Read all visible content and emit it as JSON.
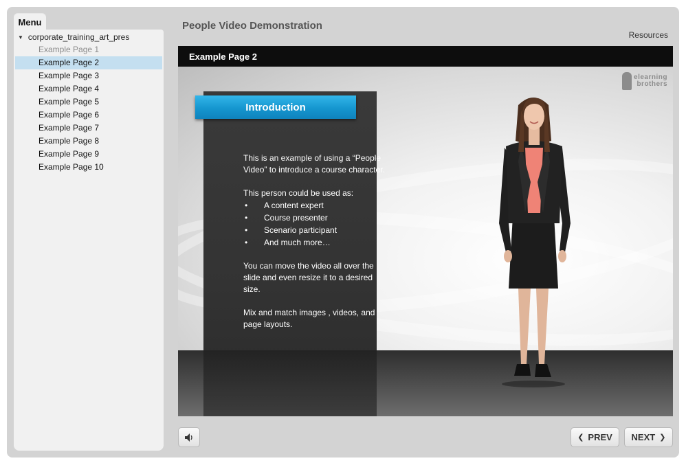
{
  "sidebar": {
    "tab_label": "Menu",
    "root_label": "corporate_training_art_pres",
    "items": [
      {
        "label": "Example Page 1",
        "state": "visited"
      },
      {
        "label": "Example Page 2",
        "state": "active"
      },
      {
        "label": "Example Page 3",
        "state": "default"
      },
      {
        "label": "Example Page 4",
        "state": "default"
      },
      {
        "label": "Example Page 5",
        "state": "default"
      },
      {
        "label": "Example Page 6",
        "state": "default"
      },
      {
        "label": "Example Page 7",
        "state": "default"
      },
      {
        "label": "Example Page 8",
        "state": "default"
      },
      {
        "label": "Example Page 9",
        "state": "default"
      },
      {
        "label": "Example Page 10",
        "state": "default"
      }
    ]
  },
  "header": {
    "title": "People Video Demonstration",
    "resources_label": "Resources",
    "page_title": "Example Page 2"
  },
  "slide": {
    "logo_line1": "elearning",
    "logo_line2": "brothers",
    "banner": "Introduction",
    "para1": "This is an example of using a “People Video” to introduce a course character.",
    "para2": "This person could be used as:",
    "bullets": [
      "A content expert",
      "Course presenter",
      "Scenario participant",
      "And much more…"
    ],
    "para3": "You can move the video all over the slide and even resize it to a desired size.",
    "para4": "Mix and match images , videos, and page layouts."
  },
  "footer": {
    "audio_icon": "speaker-icon",
    "prev_label": "PREV",
    "next_label": "NEXT"
  },
  "colors": {
    "active_item": "#c4dff0",
    "banner_blue": "#1596cf",
    "page_bar": "#0d0d0d"
  }
}
